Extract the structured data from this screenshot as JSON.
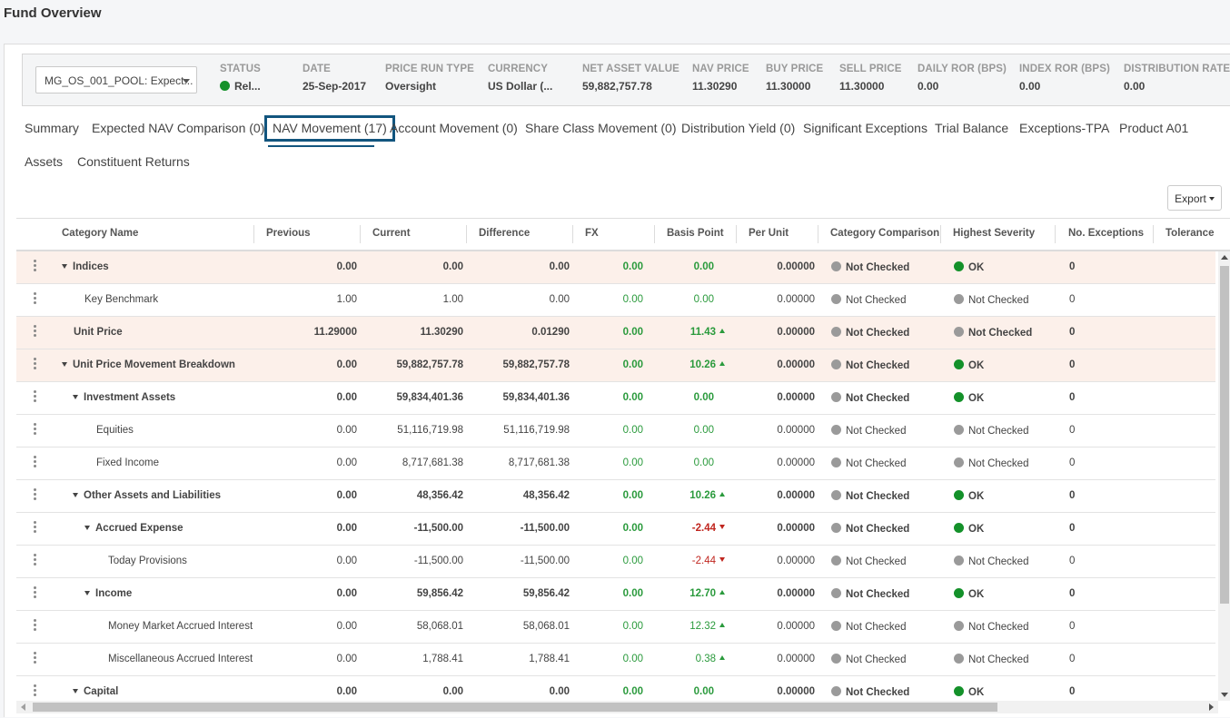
{
  "page_title": "Fund Overview",
  "fund_select": {
    "value": "MG_OS_001_POOL: Expect..."
  },
  "metrics": [
    {
      "label": "STATUS",
      "value": "Rel...",
      "status_color": "#14912a"
    },
    {
      "label": "DATE",
      "value": "25-Sep-2017"
    },
    {
      "label": "PRICE RUN TYPE",
      "value": "Oversight"
    },
    {
      "label": "CURRENCY",
      "value": "US Dollar (..."
    },
    {
      "label": "NET ASSET VALUE",
      "value": "59,882,757.78"
    },
    {
      "label": "NAV PRICE",
      "value": "11.30290"
    },
    {
      "label": "BUY PRICE",
      "value": "11.30000"
    },
    {
      "label": "SELL PRICE",
      "value": "11.30000"
    },
    {
      "label": "DAILY ROR (BPS)",
      "value": "0.00"
    },
    {
      "label": "INDEX ROR (BPS)",
      "value": "0.00"
    },
    {
      "label": "DISTRIBUTION RATE",
      "value": "0.00"
    }
  ],
  "tabs": [
    {
      "label": "Summary"
    },
    {
      "label": "Expected NAV Comparison (0)"
    },
    {
      "label": "NAV Movement (17)",
      "active": true
    },
    {
      "label": "Account Movement (0)"
    },
    {
      "label": "Share Class Movement (0)"
    },
    {
      "label": "Distribution Yield (0)"
    },
    {
      "label": "Significant Exceptions"
    },
    {
      "label": "Trial Balance"
    },
    {
      "label": "Exceptions-TPA"
    },
    {
      "label": "Product A01"
    },
    {
      "label": "Assets"
    },
    {
      "label": "Constituent Returns"
    }
  ],
  "export_label": "Export",
  "columns": [
    "Category Name",
    "Previous",
    "Current",
    "Difference",
    "FX",
    "Basis Point",
    "Per Unit",
    "Category Comparison",
    "Highest Severity",
    "No. Exceptions",
    "Tolerance"
  ],
  "rows": [
    {
      "name": "Indices",
      "level": 0,
      "expand": true,
      "bold": true,
      "hl": true,
      "previous": "0.00",
      "current": "0.00",
      "difference": "0.00",
      "fx": "0.00",
      "bp": "0.00",
      "bp_dir": "",
      "per_unit": "0.00000",
      "comparison": "Not Checked",
      "severity": "OK",
      "exceptions": "0"
    },
    {
      "name": "Key Benchmark",
      "level": 1,
      "expand": false,
      "bold": false,
      "hl": false,
      "previous": "1.00",
      "current": "1.00",
      "difference": "0.00",
      "fx": "0.00",
      "bp": "0.00",
      "bp_dir": "",
      "per_unit": "0.00000",
      "comparison": "Not Checked",
      "severity": "Not Checked",
      "exceptions": "0"
    },
    {
      "name": "Unit Price",
      "level": 0,
      "expand": false,
      "bold": true,
      "hl": true,
      "previous": "11.29000",
      "current": "11.30290",
      "difference": "0.01290",
      "fx": "0.00",
      "bp": "11.43",
      "bp_dir": "up",
      "per_unit": "0.00000",
      "comparison": "Not Checked",
      "severity": "Not Checked",
      "exceptions": "0"
    },
    {
      "name": "Unit Price Movement Breakdown",
      "level": 0,
      "expand": true,
      "bold": true,
      "hl": true,
      "previous": "0.00",
      "current": "59,882,757.78",
      "difference": "59,882,757.78",
      "fx": "0.00",
      "bp": "10.26",
      "bp_dir": "up",
      "per_unit": "0.00000",
      "comparison": "Not Checked",
      "severity": "OK",
      "exceptions": "0"
    },
    {
      "name": "Investment Assets",
      "level": 1,
      "expand": true,
      "bold": true,
      "hl": false,
      "previous": "0.00",
      "current": "59,834,401.36",
      "difference": "59,834,401.36",
      "fx": "0.00",
      "bp": "0.00",
      "bp_dir": "",
      "per_unit": "0.00000",
      "comparison": "Not Checked",
      "severity": "OK",
      "exceptions": "0"
    },
    {
      "name": "Equities",
      "level": 2,
      "expand": false,
      "bold": false,
      "hl": false,
      "previous": "0.00",
      "current": "51,116,719.98",
      "difference": "51,116,719.98",
      "fx": "0.00",
      "bp": "0.00",
      "bp_dir": "",
      "per_unit": "0.00000",
      "comparison": "Not Checked",
      "severity": "Not Checked",
      "exceptions": "0"
    },
    {
      "name": "Fixed Income",
      "level": 2,
      "expand": false,
      "bold": false,
      "hl": false,
      "previous": "0.00",
      "current": "8,717,681.38",
      "difference": "8,717,681.38",
      "fx": "0.00",
      "bp": "0.00",
      "bp_dir": "",
      "per_unit": "0.00000",
      "comparison": "Not Checked",
      "severity": "Not Checked",
      "exceptions": "0"
    },
    {
      "name": "Other Assets and Liabilities",
      "level": 1,
      "expand": true,
      "bold": true,
      "hl": false,
      "previous": "0.00",
      "current": "48,356.42",
      "difference": "48,356.42",
      "fx": "0.00",
      "bp": "10.26",
      "bp_dir": "up",
      "per_unit": "0.00000",
      "comparison": "Not Checked",
      "severity": "OK",
      "exceptions": "0"
    },
    {
      "name": "Accrued Expense",
      "level": 2,
      "expand": true,
      "bold": true,
      "hl": false,
      "previous": "0.00",
      "current": "-11,500.00",
      "difference": "-11,500.00",
      "fx": "0.00",
      "bp": "-2.44",
      "bp_dir": "down",
      "per_unit": "0.00000",
      "comparison": "Not Checked",
      "severity": "OK",
      "exceptions": "0"
    },
    {
      "name": "Today Provisions",
      "level": 3,
      "expand": false,
      "bold": false,
      "hl": false,
      "previous": "0.00",
      "current": "-11,500.00",
      "difference": "-11,500.00",
      "fx": "0.00",
      "bp": "-2.44",
      "bp_dir": "down",
      "per_unit": "0.00000",
      "comparison": "Not Checked",
      "severity": "Not Checked",
      "exceptions": "0"
    },
    {
      "name": "Income",
      "level": 2,
      "expand": true,
      "bold": true,
      "hl": false,
      "previous": "0.00",
      "current": "59,856.42",
      "difference": "59,856.42",
      "fx": "0.00",
      "bp": "12.70",
      "bp_dir": "up",
      "per_unit": "0.00000",
      "comparison": "Not Checked",
      "severity": "OK",
      "exceptions": "0"
    },
    {
      "name": "Money Market Accrued Interest",
      "level": 3,
      "expand": false,
      "bold": false,
      "hl": false,
      "previous": "0.00",
      "current": "58,068.01",
      "difference": "58,068.01",
      "fx": "0.00",
      "bp": "12.32",
      "bp_dir": "up",
      "per_unit": "0.00000",
      "comparison": "Not Checked",
      "severity": "Not Checked",
      "exceptions": "0"
    },
    {
      "name": "Miscellaneous Accrued Interest",
      "level": 3,
      "expand": false,
      "bold": false,
      "hl": false,
      "previous": "0.00",
      "current": "1,788.41",
      "difference": "1,788.41",
      "fx": "0.00",
      "bp": "0.38",
      "bp_dir": "up",
      "per_unit": "0.00000",
      "comparison": "Not Checked",
      "severity": "Not Checked",
      "exceptions": "0"
    },
    {
      "name": "Capital",
      "level": 1,
      "expand": true,
      "bold": true,
      "hl": false,
      "previous": "0.00",
      "current": "0.00",
      "difference": "0.00",
      "fx": "0.00",
      "bp": "0.00",
      "bp_dir": "",
      "per_unit": "0.00000",
      "comparison": "Not Checked",
      "severity": "OK",
      "exceptions": "0"
    }
  ],
  "colors": {
    "accent": "#12557e",
    "ok": "#14912a",
    "not_checked": "#9a9a9a",
    "positive": "#2a9a3c",
    "negative": "#c0261f",
    "highlight_row": "#fcf0ea"
  }
}
